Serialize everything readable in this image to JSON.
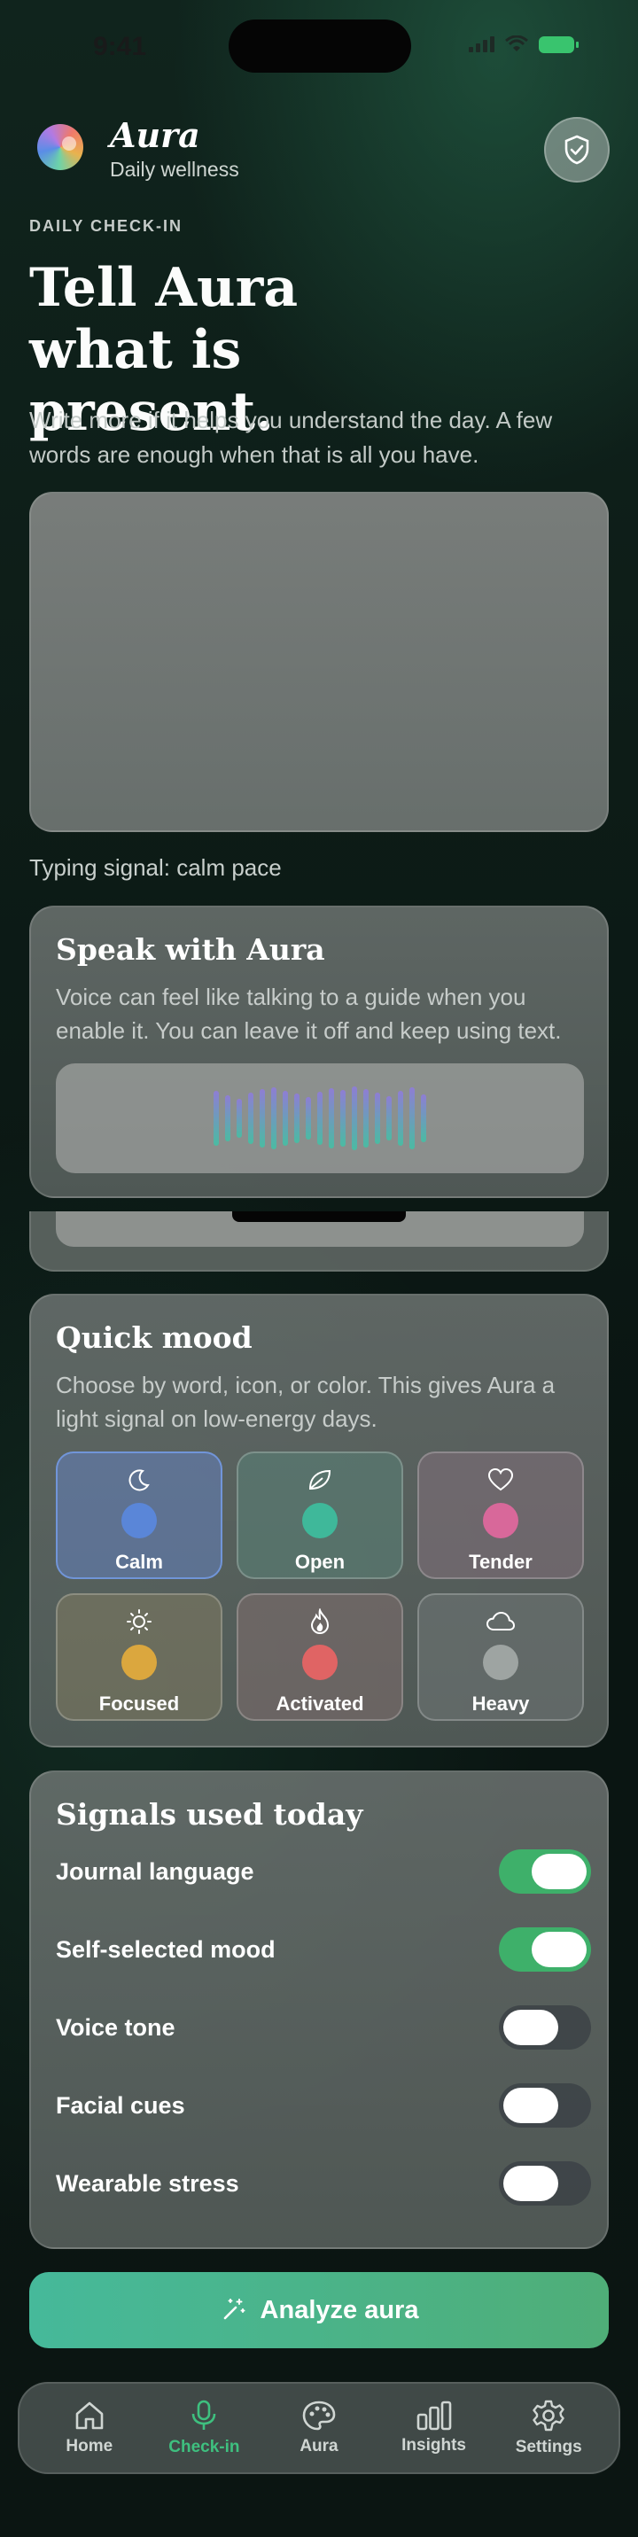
{
  "status_bar": {
    "time": "9:41"
  },
  "header": {
    "app_name": "Aura",
    "app_subtitle": "Daily wellness"
  },
  "checkin": {
    "eyebrow": "DAILY CHECK-IN",
    "headline": "Tell Aura what is present.",
    "intro": "Write more if it helps you understand the day. A few words are enough when that is all you have.",
    "journal_value": "",
    "typing_signal": "Typing signal: calm pace"
  },
  "voice": {
    "title": "Speak with Aura",
    "description": "Voice can feel like talking to a guide when you enable it. You can leave it off and keep using text."
  },
  "quick_mood": {
    "title": "Quick mood",
    "description": "Choose by word, icon, or color. This gives Aura a light signal on low-energy days.",
    "moods": [
      {
        "label": "Calm",
        "icon": "moon-icon",
        "color": "#5a86d8",
        "selected": true
      },
      {
        "label": "Open",
        "icon": "leaf-icon",
        "color": "#3fb89a",
        "selected": false
      },
      {
        "label": "Tender",
        "icon": "heart-icon",
        "color": "#d8689a",
        "selected": false
      },
      {
        "label": "Focused",
        "icon": "sun-icon",
        "color": "#dba73e",
        "selected": false
      },
      {
        "label": "Activated",
        "icon": "flame-icon",
        "color": "#e06464",
        "selected": false
      },
      {
        "label": "Heavy",
        "icon": "cloud-icon",
        "color": "#9ea4a2",
        "selected": false
      }
    ]
  },
  "signals": {
    "title": "Signals used today",
    "items": [
      {
        "label": "Journal language",
        "enabled": true
      },
      {
        "label": "Self-selected mood",
        "enabled": true
      },
      {
        "label": "Voice tone",
        "enabled": false
      },
      {
        "label": "Facial cues",
        "enabled": false
      },
      {
        "label": "Wearable stress",
        "enabled": false
      }
    ]
  },
  "analyze": {
    "label": "Analyze aura"
  },
  "tabbar": {
    "tabs": [
      {
        "label": "Home",
        "icon": "home-icon",
        "active": false
      },
      {
        "label": "Check-in",
        "icon": "microphone-icon",
        "active": true
      },
      {
        "label": "Aura",
        "icon": "palette-icon",
        "active": false
      },
      {
        "label": "Insights",
        "icon": "bar-chart-icon",
        "active": false
      },
      {
        "label": "Settings",
        "icon": "gear-icon",
        "active": false
      }
    ]
  },
  "colors": {
    "accent": "#3eb06a",
    "accent_teal": "#46b99a",
    "active_tab": "#3ec07f"
  }
}
